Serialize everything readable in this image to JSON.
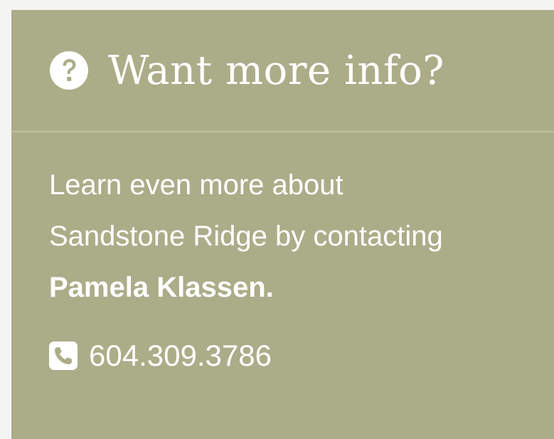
{
  "panel": {
    "title": "Want more info?",
    "title_icon": "question-circle-icon",
    "body_lines": [
      "Learn even more about",
      "Sandstone Ridge by contacting"
    ],
    "contact_name": "Pamela Klassen.",
    "phone": {
      "icon": "phone-icon",
      "number": "604.309.3786"
    },
    "colors": {
      "background": "#abad89",
      "text": "#ffffff",
      "divider": "#bdbf9f",
      "page": "#f4f4f2"
    }
  }
}
